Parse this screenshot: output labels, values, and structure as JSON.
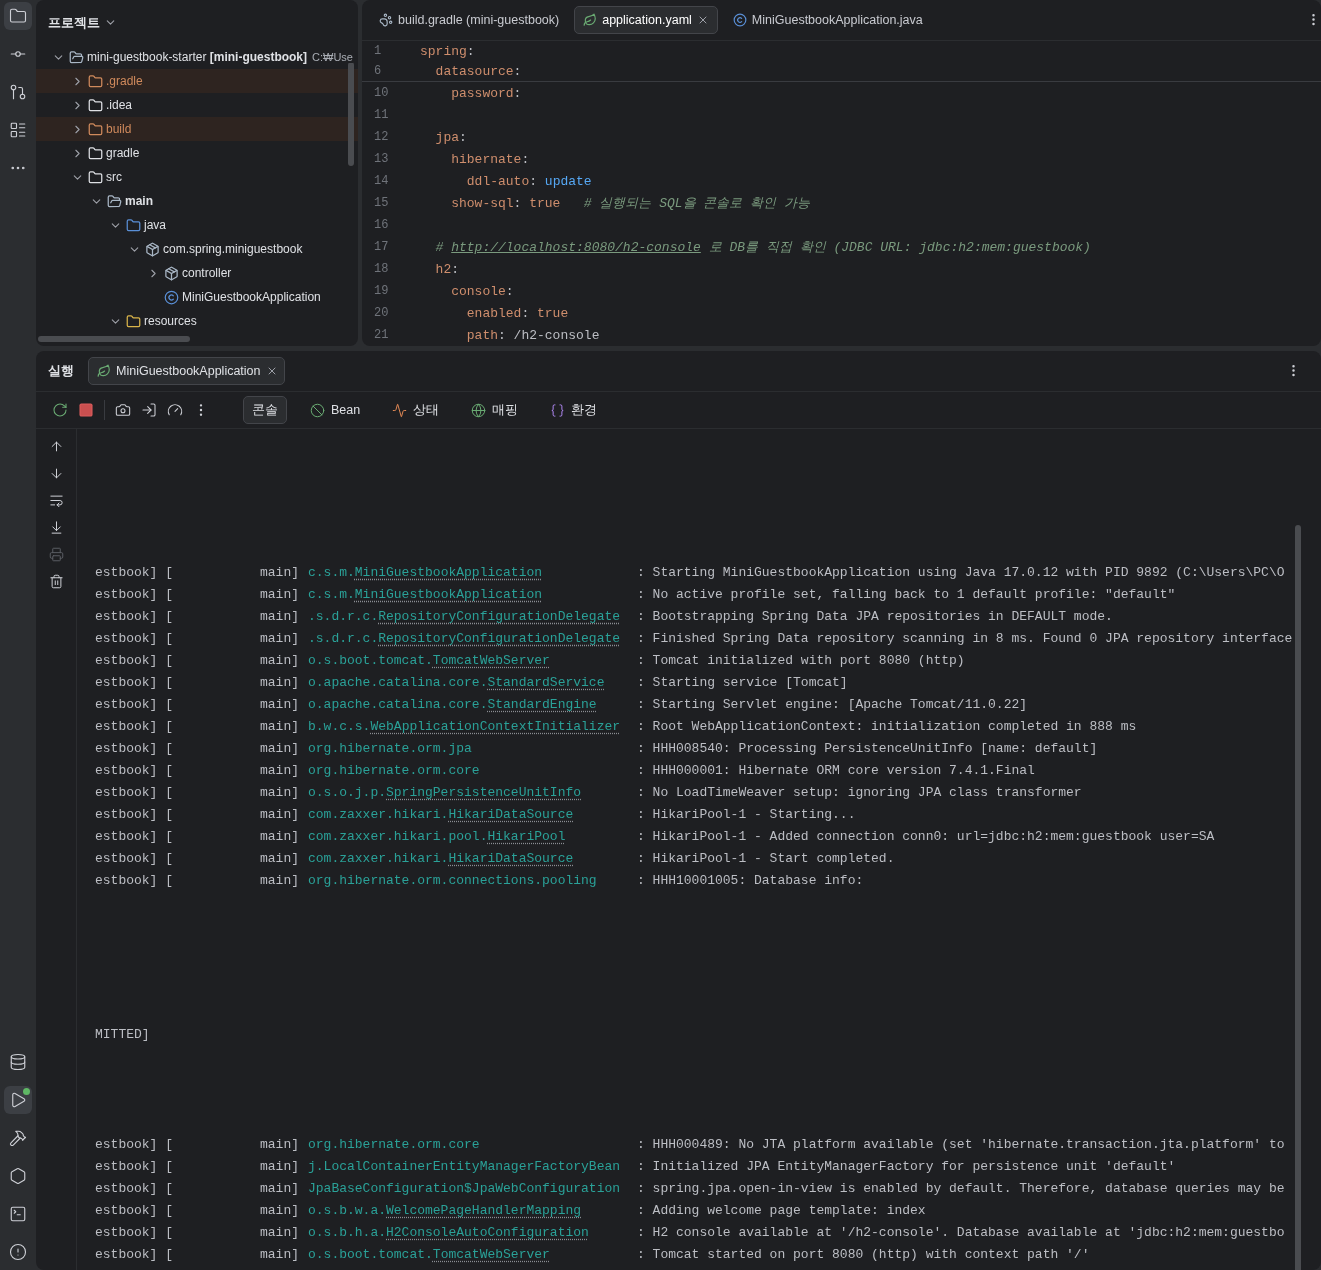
{
  "activity_bar": {
    "top": [
      {
        "kind": "project",
        "selected": true
      },
      {
        "kind": "commit",
        "selected": false
      },
      {
        "kind": "pull-requests",
        "selected": false
      },
      {
        "kind": "structure",
        "selected": false
      },
      {
        "kind": "more",
        "selected": false
      }
    ],
    "bottom": [
      {
        "kind": "database",
        "selected": false
      },
      {
        "kind": "run",
        "selected": true
      },
      {
        "kind": "build",
        "selected": false
      },
      {
        "kind": "services",
        "selected": false
      },
      {
        "kind": "terminal",
        "selected": false
      },
      {
        "kind": "problems",
        "selected": false
      }
    ]
  },
  "project": {
    "title": "프로젝트",
    "tree": [
      {
        "name": "mini-guestbook-starter **[mini-guestbook]**",
        "path": "C:₩Use",
        "kind": "module",
        "expanded": true,
        "excluded": false,
        "children": [
          {
            "name": ".gradle",
            "kind": "folder",
            "expanded": false,
            "excluded": true
          },
          {
            "name": ".idea",
            "kind": "folder",
            "expanded": false,
            "excluded": false
          },
          {
            "name": "build",
            "kind": "folder",
            "expanded": false,
            "excluded": true
          },
          {
            "name": "gradle",
            "kind": "folder",
            "expanded": false,
            "excluded": false
          },
          {
            "name": "src",
            "kind": "folder",
            "expanded": true,
            "excluded": false,
            "children": [
              {
                "name": "main",
                "kind": "module",
                "bold": true,
                "expanded": true,
                "excluded": false,
                "children": [
                  {
                    "name": "java",
                    "kind": "source",
                    "expanded": true,
                    "excluded": false,
                    "children": [
                      {
                        "name": "com.spring.miniguestbook",
                        "kind": "package",
                        "expanded": true,
                        "excluded": false,
                        "children": [
                          {
                            "name": "controller",
                            "kind": "package",
                            "expanded": false,
                            "excluded": false
                          },
                          {
                            "name": "MiniGuestbookApplication",
                            "kind": "app",
                            "excluded": false
                          }
                        ]
                      }
                    ]
                  },
                  {
                    "name": "resources",
                    "kind": "resources",
                    "expanded": true,
                    "excluded": false
                  }
                ]
              }
            ]
          }
        ]
      }
    ]
  },
  "editor": {
    "tabs": [
      {
        "label": "build.gradle (mini-guestbook)",
        "kind": "gradle",
        "selected": false
      },
      {
        "label": "application.yaml",
        "kind": "yaml",
        "selected": true
      },
      {
        "label": "MiniGuestbookApplication.java",
        "kind": "java",
        "selected": false
      }
    ],
    "lines": [
      {
        "number": "1",
        "sticky": true,
        "tokens": [
          {
            "kind": "key",
            "text": "spring"
          },
          {
            "kind": "plain",
            "text": ":"
          }
        ],
        "children": [
          {
            "number": "6",
            "sticky": true,
            "tokens": [
              {
                "kind": "key",
                "text": "datasource"
              },
              {
                "kind": "plain",
                "text": ":"
              }
            ],
            "children": [
              {
                "number": "10",
                "sticky": false,
                "tokens": [
                  {
                    "kind": "key",
                    "text": "password"
                  },
                  {
                    "kind": "plain",
                    "text": ":"
                  }
                ]
              }
            ]
          },
          {
            "number": "11",
            "sticky": false
          },
          {
            "number": "12",
            "sticky": false,
            "tokens": [
              {
                "kind": "key",
                "text": "jpa"
              },
              {
                "kind": "plain",
                "text": ":"
              }
            ],
            "children": [
              {
                "number": "13",
                "sticky": false,
                "tokens": [
                  {
                    "kind": "key",
                    "text": "hibernate"
                  },
                  {
                    "kind": "plain",
                    "text": ":"
                  }
                ],
                "children": [
                  {
                    "number": "14",
                    "sticky": false,
                    "tokens": [
                      {
                        "kind": "key",
                        "text": "ddl-auto"
                      },
                      {
                        "kind": "plain",
                        "text": ": "
                      },
                      {
                        "kind": "value",
                        "text": "update"
                      }
                    ]
                  }
                ]
              },
              {
                "number": "15",
                "sticky": false,
                "tokens": [
                  {
                    "kind": "key",
                    "text": "show-sql"
                  },
                  {
                    "kind": "plain",
                    "text": ": "
                  },
                  {
                    "kind": "keyword",
                    "text": "true"
                  },
                  {
                    "kind": "comment",
                    "text": "   # 실행되는 SQL을 콘솔로 확인 가능"
                  }
                ]
              }
            ]
          },
          {
            "number": "16",
            "sticky": false
          },
          {
            "number": "17",
            "sticky": false,
            "tokens": [
              {
                "kind": "comment",
                "text": "# "
              },
              {
                "kind": "link",
                "text": "http://localhost:8080/h2-console"
              },
              {
                "kind": "comment",
                "text": " 로 DB를 직접 확인 (JDBC URL: jdbc:h2:mem:guestbook)"
              }
            ]
          },
          {
            "number": "18",
            "sticky": false,
            "tokens": [
              {
                "kind": "key",
                "text": "h2"
              },
              {
                "kind": "plain",
                "text": ":"
              }
            ],
            "children": [
              {
                "number": "19",
                "sticky": false,
                "tokens": [
                  {
                    "kind": "key",
                    "text": "console"
                  },
                  {
                    "kind": "plain",
                    "text": ":"
                  }
                ],
                "children": [
                  {
                    "number": "20",
                    "sticky": false,
                    "tokens": [
                      {
                        "kind": "key",
                        "text": "enabled"
                      },
                      {
                        "kind": "plain",
                        "text": ": "
                      },
                      {
                        "kind": "keyword",
                        "text": "true"
                      }
                    ]
                  },
                  {
                    "number": "21",
                    "sticky": false,
                    "tokens": [
                      {
                        "kind": "key",
                        "text": "path"
                      },
                      {
                        "kind": "plain",
                        "text": ": /h2-console"
                      }
                    ]
                  }
                ]
              }
            ]
          }
        ]
      }
    ]
  },
  "run": {
    "title": "실행",
    "tab": {
      "label": "MiniGuestbookApplication"
    },
    "actions": [
      {
        "kind": "rerun"
      },
      {
        "kind": "stop"
      },
      {
        "kind": "snapshot"
      },
      {
        "kind": "exit"
      },
      {
        "kind": "profiler"
      },
      {
        "kind": "more"
      }
    ],
    "views": [
      {
        "label": "콘솔",
        "kind": "console",
        "selected": true
      },
      {
        "label": "Bean",
        "kind": "bean",
        "selected": false
      },
      {
        "label": "상태",
        "kind": "health",
        "selected": false
      },
      {
        "label": "매핑",
        "kind": "mapping",
        "selected": false
      },
      {
        "label": "환경",
        "kind": "environment",
        "selected": false
      }
    ],
    "console_tools": [
      {
        "kind": "up",
        "disabled": false
      },
      {
        "kind": "down",
        "disabled": false
      },
      {
        "kind": "wrap",
        "disabled": false
      },
      {
        "kind": "scroll-end",
        "disabled": false
      },
      {
        "kind": "print",
        "disabled": true
      },
      {
        "kind": "clear",
        "disabled": false
      }
    ],
    "console": [
      {
        "kind": "blank"
      },
      {
        "kind": "blank"
      },
      {
        "kind": "blank"
      },
      {
        "kind": "blank"
      },
      {
        "kind": "blank"
      },
      {
        "kind": "blank"
      },
      {
        "kind": "log",
        "source": "estbook] [",
        "thread": "main]",
        "package": "c.s.m.",
        "class": "MiniGuestbookApplication",
        "message": ": Starting MiniGuestbookApplication using Java 17.0.12 with PID 9892 (C:\\Users\\PC\\O"
      },
      {
        "kind": "log",
        "source": "estbook] [",
        "thread": "main]",
        "package": "c.s.m.",
        "class": "MiniGuestbookApplication",
        "message": ": No active profile set, falling back to 1 default profile: \"default\""
      },
      {
        "kind": "log",
        "source": "estbook] [",
        "thread": "main]",
        "package": ".s.d.r.c.",
        "class": "RepositoryConfigurationDelegate",
        "message": ": Bootstrapping Spring Data JPA repositories in DEFAULT mode."
      },
      {
        "kind": "log",
        "source": "estbook] [",
        "thread": "main]",
        "package": ".s.d.r.c.",
        "class": "RepositoryConfigurationDelegate",
        "message": ": Finished Spring Data repository scanning in 8 ms. Found 0 JPA repository interface"
      },
      {
        "kind": "log",
        "source": "estbook] [",
        "thread": "main]",
        "package": "o.s.boot.tomcat.",
        "class": "TomcatWebServer",
        "message": ": Tomcat initialized with port 8080 (http)"
      },
      {
        "kind": "log",
        "source": "estbook] [",
        "thread": "main]",
        "package": "o.apache.catalina.core.",
        "class": "StandardService",
        "message": ": Starting service [Tomcat]"
      },
      {
        "kind": "log",
        "source": "estbook] [",
        "thread": "main]",
        "package": "o.apache.catalina.core.",
        "class": "StandardEngine",
        "message": ": Starting Servlet engine: [Apache Tomcat/11.0.22]"
      },
      {
        "kind": "log",
        "source": "estbook] [",
        "thread": "main]",
        "package": "b.w.c.s.",
        "class": "WebApplicationContextInitializer",
        "message": ": Root WebApplicationContext: initialization completed in 888 ms"
      },
      {
        "kind": "log",
        "source": "estbook] [",
        "thread": "main]",
        "package": "org.hibernate.orm.jpa",
        "message": ": HHH008540: Processing PersistenceUnitInfo [name: default]"
      },
      {
        "kind": "log",
        "source": "estbook] [",
        "thread": "main]",
        "package": "org.hibernate.orm.core",
        "message": ": HHH000001: Hibernate ORM core version 7.4.1.Final"
      },
      {
        "kind": "log",
        "source": "estbook] [",
        "thread": "main]",
        "package": "o.s.o.j.p.",
        "class": "SpringPersistenceUnitInfo",
        "message": ": No LoadTimeWeaver setup: ignoring JPA class transformer"
      },
      {
        "kind": "log",
        "source": "estbook] [",
        "thread": "main]",
        "package": "com.zaxxer.hikari.",
        "class": "HikariDataSource",
        "message": ": HikariPool-1 - Starting..."
      },
      {
        "kind": "log",
        "source": "estbook] [",
        "thread": "main]",
        "package": "com.zaxxer.hikari.pool.",
        "class": "HikariPool",
        "message": ": HikariPool-1 - Added connection conn0: url=jdbc:h2:mem:guestbook user=SA"
      },
      {
        "kind": "log",
        "source": "estbook] [",
        "thread": "main]",
        "package": "com.zaxxer.hikari.",
        "class": "HikariDataSource",
        "message": ": HikariPool-1 - Start completed."
      },
      {
        "kind": "log",
        "source": "estbook] [",
        "thread": "main]",
        "package": "org.hibernate.orm.connections.pooling",
        "message": ": HHH10001005: Database info:"
      },
      {
        "kind": "blank"
      },
      {
        "kind": "blank"
      },
      {
        "kind": "blank"
      },
      {
        "kind": "blank"
      },
      {
        "kind": "blank"
      },
      {
        "kind": "blank"
      },
      {
        "kind": "raw",
        "text": "MITTED]"
      },
      {
        "kind": "blank"
      },
      {
        "kind": "blank"
      },
      {
        "kind": "blank"
      },
      {
        "kind": "blank"
      },
      {
        "kind": "log",
        "source": "estbook] [",
        "thread": "main]",
        "package": "org.hibernate.orm.core",
        "message": ": HHH000489: No JTA platform available (set 'hibernate.transaction.jta.platform' to"
      },
      {
        "kind": "log",
        "source": "estbook] [",
        "thread": "main]",
        "package": "j.LocalContainerEntityManagerFactoryBean",
        "message": ": Initialized JPA EntityManagerFactory for persistence unit 'default'"
      },
      {
        "kind": "log",
        "source": "estbook] [",
        "thread": "main]",
        "package": "JpaBaseConfiguration$JpaWebConfiguration",
        "message": ": spring.jpa.open-in-view is enabled by default. Therefore, database queries may be"
      },
      {
        "kind": "log",
        "source": "estbook] [",
        "thread": "main]",
        "package": "o.s.b.w.a.",
        "class": "WelcomePageHandlerMapping",
        "message": ": Adding welcome page template: index"
      },
      {
        "kind": "log",
        "source": "estbook] [",
        "thread": "main]",
        "package": "o.s.b.h.a.",
        "class": "H2ConsoleAutoConfiguration",
        "message": ": H2 console available at '/h2-console'. Database available at 'jdbc:h2:mem:guestbo"
      },
      {
        "kind": "log",
        "source": "estbook] [",
        "thread": "main]",
        "package": "o.s.boot.tomcat.",
        "class": "TomcatWebServer",
        "message": ": Tomcat started on port 8080 (http) with context path '/'"
      }
    ]
  }
}
